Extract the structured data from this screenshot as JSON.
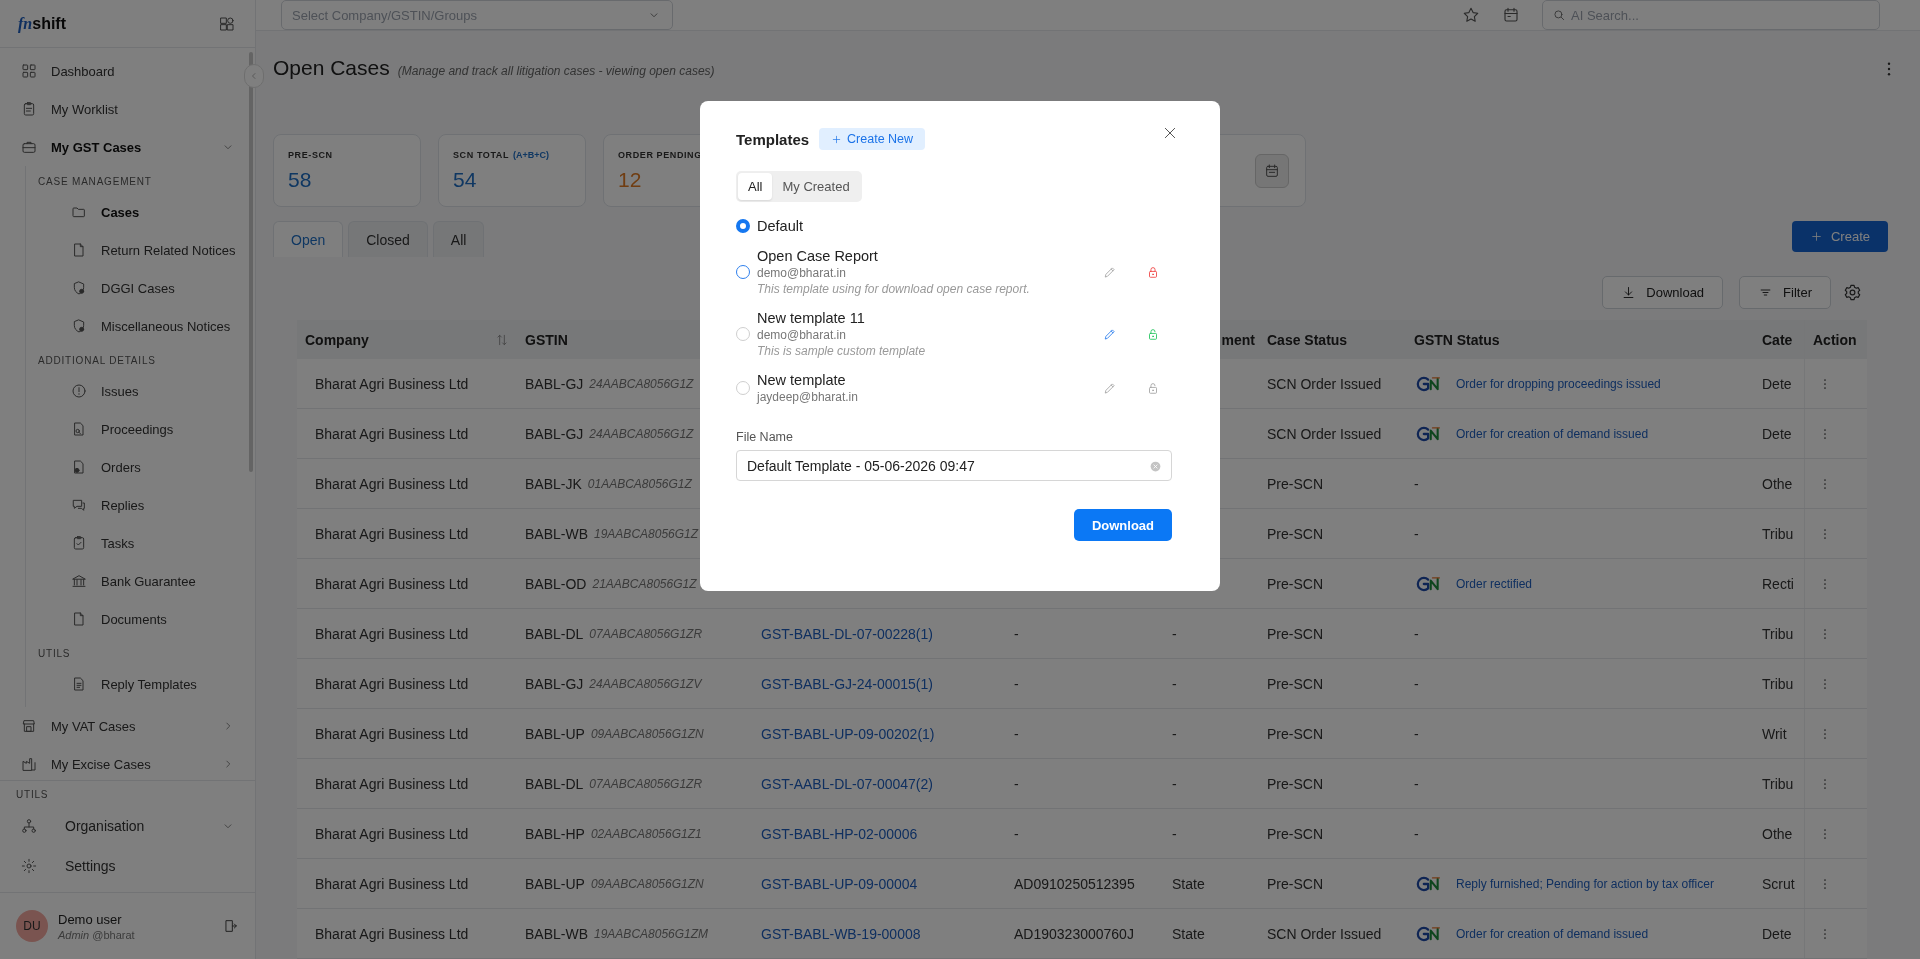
{
  "sidebar": {
    "logo_prefix": "fn",
    "logo_main": "shift",
    "nav": [
      {
        "kind": "link",
        "label": "Dashboard",
        "selected": false
      },
      {
        "kind": "link",
        "label": "My Worklist",
        "selected": false
      },
      {
        "kind": "group",
        "label": "My GST Cases",
        "expanded": true,
        "sections": [
          {
            "title": "CASE MANAGEMENT",
            "children": [
              {
                "label": "Cases",
                "selected": true
              },
              {
                "label": "Return Related Notices",
                "selected": false
              },
              {
                "label": "DGGI Cases",
                "selected": false
              },
              {
                "label": "Miscellaneous Notices",
                "selected": false
              }
            ]
          },
          {
            "title": "ADDITIONAL DETAILS",
            "children": [
              {
                "label": "Issues",
                "selected": false
              },
              {
                "label": "Proceedings",
                "selected": false
              },
              {
                "label": "Orders",
                "selected": false
              },
              {
                "label": "Replies",
                "selected": false
              },
              {
                "label": "Tasks",
                "selected": false
              },
              {
                "label": "Bank Guarantee",
                "selected": false
              },
              {
                "label": "Documents",
                "selected": false
              }
            ]
          },
          {
            "title": "UTILS",
            "children": [
              {
                "label": "Reply Templates",
                "selected": false
              }
            ]
          }
        ]
      },
      {
        "kind": "group",
        "label": "My VAT Cases",
        "expanded": false
      },
      {
        "kind": "group",
        "label": "My Excise Cases",
        "expanded": false
      }
    ],
    "footer_title": "UTILS",
    "footer_items": [
      {
        "kind": "menu",
        "label": "Organisation"
      },
      {
        "kind": "link",
        "label": "Settings"
      }
    ],
    "user": {
      "initials": "DU",
      "name": "Demo user",
      "role": "*Admin* @bharat"
    }
  },
  "topbar": {
    "company_select": {
      "placeholder": "Select Company/GSTIN/Groups"
    },
    "search": {
      "placeholder": "AI Search..."
    }
  },
  "page": {
    "title": "Open Cases",
    "subtitle": "(Manage and track all litigation cases - viewing open cases)"
  },
  "stats": [
    {
      "label": "PRE-SCN",
      "value": "58",
      "kind": "count"
    },
    {
      "label": "SCN TOTAL",
      "note": "(A+B+C)",
      "value": "54",
      "kind": "count"
    },
    {
      "label": "ORDER PENDING",
      "value": "12",
      "kind": "pending"
    }
  ],
  "page_tabs": [
    {
      "label": "Open",
      "selected": true
    },
    {
      "label": "Closed",
      "selected": false
    },
    {
      "label": "All",
      "selected": false
    }
  ],
  "create_button": "Create",
  "toolbar": {
    "download": "Download",
    "filter": "Filter"
  },
  "table": {
    "columns": {
      "company": "Company",
      "gstin": "GSTIN",
      "column_5": "ment",
      "case_status": "Case Status",
      "gstn_status": "GSTN Status",
      "column_8": "Cate",
      "action": "Action"
    },
    "rows": [
      {
        "company": "Bharat Agri Business Ltd",
        "gstin_code": "BABL-GJ",
        "gstin_number": "24AABCA8056G1Z",
        "case_status": "SCN Order Issued",
        "gstn_status": {
          "logo": true,
          "text": "Order for dropping proceedings issued"
        },
        "column_8": "Dete"
      },
      {
        "company": "Bharat Agri Business Ltd",
        "gstin_code": "BABL-GJ",
        "gstin_number": "24AABCA8056G1Z",
        "case_status": "SCN Order Issued",
        "gstn_status": {
          "logo": true,
          "text": "Order for creation of demand issued"
        },
        "column_8": "Dete"
      },
      {
        "company": "Bharat Agri Business Ltd",
        "gstin_code": "BABL-JK",
        "gstin_number": "01AABCA8056G1Z",
        "case_status": "Pre-SCN",
        "gstn_status": {
          "logo": false,
          "text": "-"
        },
        "column_8": "Othe"
      },
      {
        "company": "Bharat Agri Business Ltd",
        "gstin_code": "BABL-WB",
        "gstin_number": "19AABCA8056G1Z",
        "case_status": "Pre-SCN",
        "gstn_status": {
          "logo": false,
          "text": "-"
        },
        "column_8": "Tribu"
      },
      {
        "company": "Bharat Agri Business Ltd",
        "gstin_code": "BABL-OD",
        "gstin_number": "21AABCA8056G1Z",
        "case_status": "Pre-SCN",
        "gstn_status": {
          "logo": true,
          "text": "Order rectified"
        },
        "column_8": "Recti"
      },
      {
        "company": "Bharat Agri Business Ltd",
        "gstin_code": "BABL-DL",
        "gstin_number": "07AABCA8056G1ZR",
        "column_3": "GST-BABL-DL-07-00228(1)",
        "column_4": "-",
        "column_5": "-",
        "case_status": "Pre-SCN",
        "gstn_status": {
          "logo": false,
          "text": "-"
        },
        "column_8": "Tribu"
      },
      {
        "company": "Bharat Agri Business Ltd",
        "gstin_code": "BABL-GJ",
        "gstin_number": "24AABCA8056G1ZV",
        "column_3": "GST-BABL-GJ-24-00015(1)",
        "column_4": "-",
        "column_5": "-",
        "case_status": "Pre-SCN",
        "gstn_status": {
          "logo": false,
          "text": "-"
        },
        "column_8": "Tribu"
      },
      {
        "company": "Bharat Agri Business Ltd",
        "gstin_code": "BABL-UP",
        "gstin_number": "09AABCA8056G1ZN",
        "column_3": "GST-BABL-UP-09-00202(1)",
        "column_4": "-",
        "column_5": "-",
        "case_status": "Pre-SCN",
        "gstn_status": {
          "logo": false,
          "text": "-"
        },
        "column_8": "Writ"
      },
      {
        "company": "Bharat Agri Business Ltd",
        "gstin_code": "BABL-DL",
        "gstin_number": "07AABCA8056G1ZR",
        "column_3": "GST-AABL-DL-07-00047(2)",
        "column_4": "-",
        "column_5": "-",
        "case_status": "Pre-SCN",
        "gstn_status": {
          "logo": false,
          "text": "-"
        },
        "column_8": "Tribu"
      },
      {
        "company": "Bharat Agri Business Ltd",
        "gstin_code": "BABL-HP",
        "gstin_number": "02AABCA8056G1Z1",
        "column_3": "GST-BABL-HP-02-00006",
        "column_4": "-",
        "column_5": "-",
        "case_status": "Pre-SCN",
        "gstn_status": {
          "logo": false,
          "text": "-"
        },
        "column_8": "Othe"
      },
      {
        "company": "Bharat Agri Business Ltd",
        "gstin_code": "BABL-UP",
        "gstin_number": "09AABCA8056G1ZN",
        "column_3": "GST-BABL-UP-09-00004",
        "column_4": "AD0910250512395",
        "column_5": "State",
        "case_status": "Pre-SCN",
        "gstn_status": {
          "logo": true,
          "text": "Reply furnished; Pending for action by tax officer"
        },
        "column_8": "Scrut"
      },
      {
        "company": "Bharat Agri Business Ltd",
        "gstin_code": "BABL-WB",
        "gstin_number": "19AABCA8056G1ZM",
        "column_3": "GST-BABL-WB-19-00008",
        "column_4": "AD190323000760J",
        "column_5": "State",
        "case_status": "SCN Order Issued",
        "gstn_status": {
          "logo": true,
          "text": "Order for creation of demand issued"
        },
        "column_8": "Dete"
      }
    ]
  },
  "modal": {
    "title": "Templates",
    "create_new": "Create New",
    "tabs": [
      {
        "label": "All",
        "selected": true
      },
      {
        "label": "My Created",
        "selected": false
      }
    ],
    "templates": [
      {
        "kind": "default",
        "name": "Default",
        "selected": true
      },
      {
        "kind": "custom",
        "name": "Open Case Report",
        "email": "demo@bharat.in",
        "description": "This template using for download open case report.",
        "selected": false,
        "editable": false,
        "locked": true
      },
      {
        "kind": "custom",
        "name": "New template 11",
        "email": "demo@bharat.in",
        "description": "This is sample custom template",
        "selected": false,
        "editable": true,
        "locked": false
      },
      {
        "kind": "custom",
        "name": "New template",
        "email": "jaydeep@bharat.in",
        "selected": false,
        "editable": false,
        "locked": false
      }
    ],
    "file_name_label": "File Name",
    "file_name": "Default Template - 05-06-2026 09:47",
    "download": "Download"
  }
}
